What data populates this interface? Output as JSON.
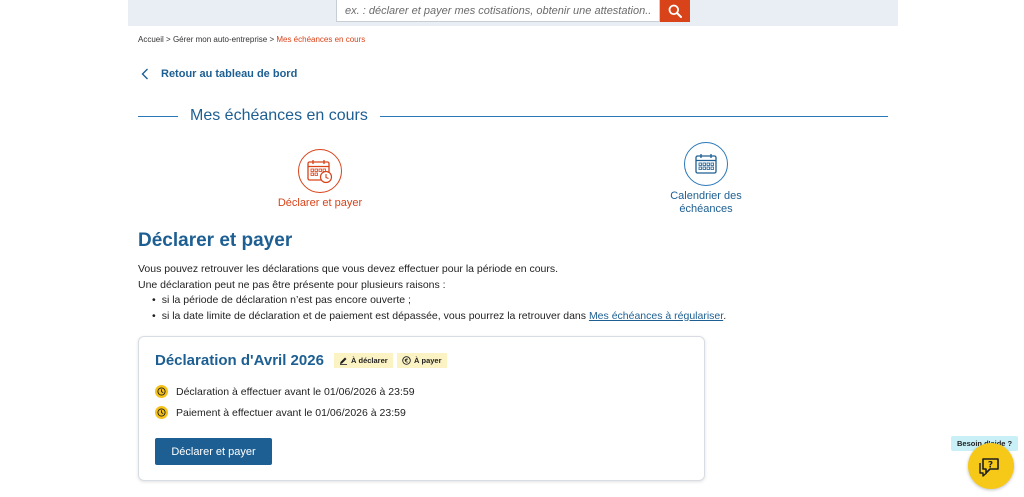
{
  "search": {
    "placeholder": "ex. : déclarer et payer mes cotisations, obtenir une attestation...",
    "button_icon": "search-icon"
  },
  "breadcrumb": {
    "items": [
      "Accueil",
      "Gérer mon auto-entreprise",
      "Mes échéances en cours"
    ],
    "separator": ">"
  },
  "back_link": {
    "label": "Retour au tableau de bord",
    "icon": "chevron-left-icon"
  },
  "section_title": "Mes échéances en cours",
  "tiles": [
    {
      "label": "Déclarer et payer",
      "icon": "calendar-clock-icon",
      "active": true,
      "color": "#d8431a"
    },
    {
      "label": "Calendrier des échéances",
      "icon": "calendar-icon",
      "active": false,
      "color": "#1d5f92"
    }
  ],
  "main": {
    "heading": "Déclarer et payer",
    "intro_line1": "Vous pouvez retrouver les déclarations que vous devez effectuer pour la période en cours.",
    "intro_line2": "Une déclaration peut ne pas être présente pour plusieurs raisons :",
    "bullet1": "si la période de déclaration n’est pas encore ouverte ;",
    "bullet2_prefix": "si la date limite de déclaration et de paiement est dépassée, vous pourrez la retrouver dans ",
    "bullet2_link": "Mes échéances à régulariser",
    "bullet2_suffix": "."
  },
  "card": {
    "title": "Déclaration d'Avril 2026",
    "badge_declare": "À déclarer",
    "badge_pay": "À payer",
    "due_declaration": "Déclaration à effectuer avant le 01/06/2026 à 23:59",
    "due_payment": "Paiement à effectuer avant le 01/06/2026 à 23:59",
    "button_label": "Déclarer et payer"
  },
  "help": {
    "label": "Besoin d'aide ?",
    "icon": "help-chat-icon"
  },
  "colors": {
    "brand_blue": "#1d5f92",
    "accent_orange": "#d8431a",
    "badge_yellow": "#fcf3c5",
    "help_yellow": "#f6c817"
  }
}
